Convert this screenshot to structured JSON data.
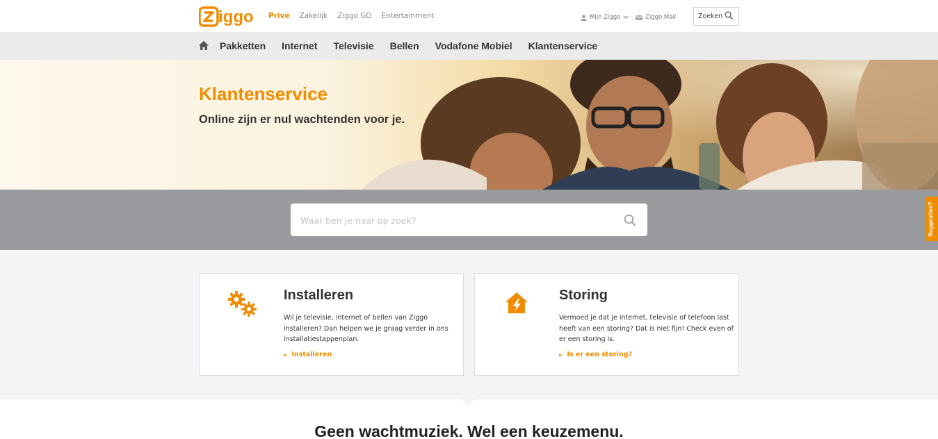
{
  "brand": {
    "logo_text": "Ziggo",
    "accent_color": "#f08c00"
  },
  "topnav": {
    "items": [
      {
        "label": "Privé",
        "active": true
      },
      {
        "label": "Zakelijk"
      },
      {
        "label": "Ziggo GO"
      },
      {
        "label": "Entertainment"
      }
    ],
    "mijn_ziggo": "Mijn Ziggo",
    "ziggo_mail": "Ziggo Mail",
    "search_label": "Zoeken"
  },
  "mainnav": {
    "home_icon": "home-icon",
    "items": [
      "Pakketten",
      "Internet",
      "Televisie",
      "Bellen",
      "Vodafone Mobiel",
      "Klantenservice"
    ]
  },
  "hero": {
    "title": "Klantenservice",
    "subtitle": "Online zijn er nul wachtenden voor je."
  },
  "search": {
    "placeholder": "Waar ben je naar op zoek?"
  },
  "feedback_tab": "Suggesties?",
  "cards": [
    {
      "icon": "gears-icon",
      "title": "Installeren",
      "description": "Wil je televisie, internet of bellen van Ziggo installeren? Dan helpen we je graag verder in ons installatiestappenplan.",
      "link": "Installeren"
    },
    {
      "icon": "house-lightning-icon",
      "title": "Storing",
      "description": "Vermoed je dat je internet, televisie of telefoon last heeft van een storing? Dat is niet fijn! Check even of er een storing is.",
      "link": "Is er een storing?"
    }
  ],
  "bottom_heading": "Geen wachtmuziek. Wel een keuzemenu."
}
